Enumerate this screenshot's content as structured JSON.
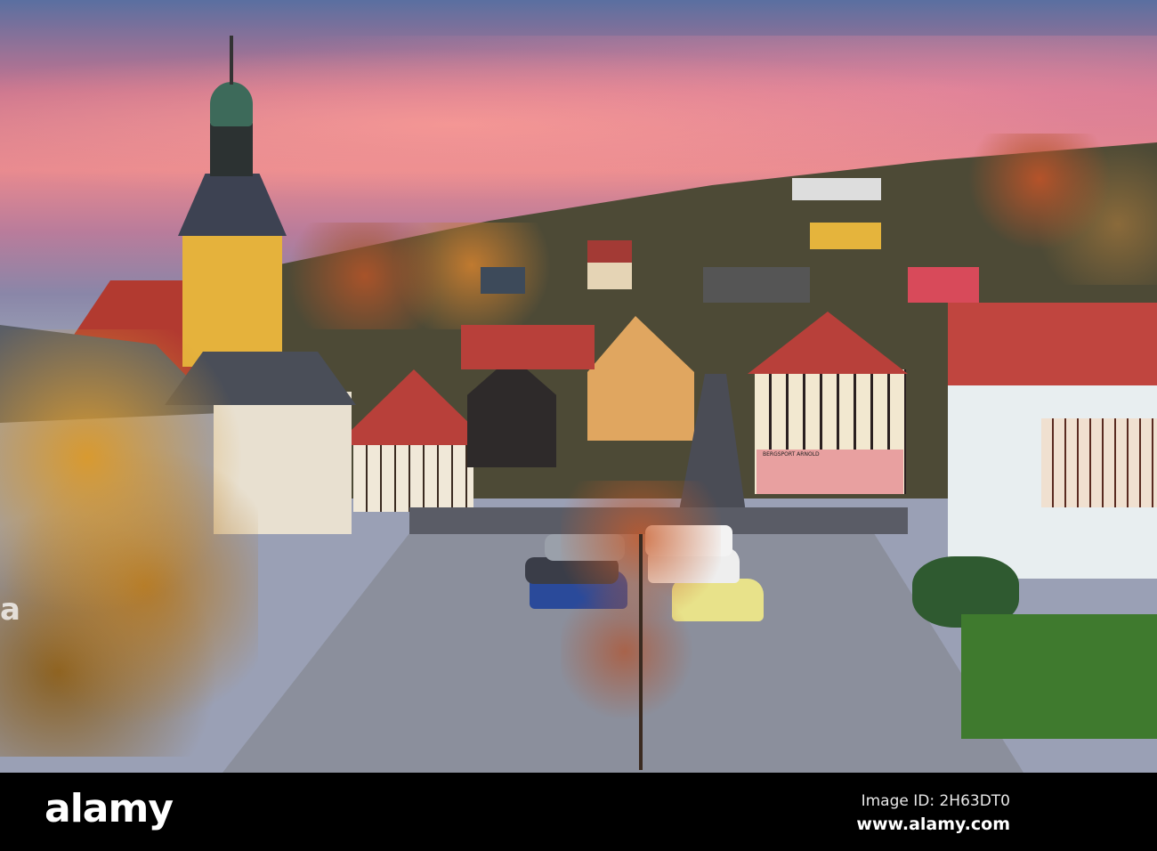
{
  "photo": {
    "sign_text": "BERGSPORT ARNOLD"
  },
  "watermark": {
    "logo": "alamy",
    "image_id": "Image ID: 2H63DT0",
    "url": "www.alamy.com"
  },
  "colors": {
    "sky_pink": "#e88a8f",
    "sky_blue": "#5a6fa0",
    "tower": "#e9b43c",
    "roof": "#b8403a"
  }
}
